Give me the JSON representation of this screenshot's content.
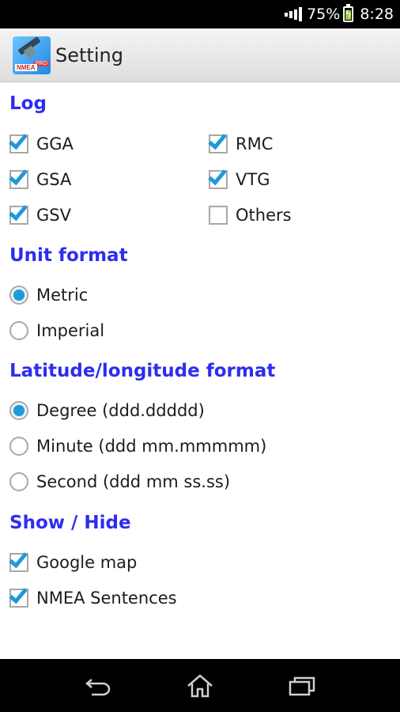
{
  "status_bar": {
    "battery_percent": "75%",
    "time": "8:28"
  },
  "action_bar": {
    "app_icon_text": "NMEA",
    "app_icon_badge": "PRO",
    "title": "Setting"
  },
  "sections": {
    "log": {
      "title": "Log",
      "items": [
        {
          "label": "GGA",
          "checked": true
        },
        {
          "label": "RMC",
          "checked": true
        },
        {
          "label": "GSA",
          "checked": true
        },
        {
          "label": "VTG",
          "checked": true
        },
        {
          "label": "GSV",
          "checked": true
        },
        {
          "label": "Others",
          "checked": false
        }
      ]
    },
    "unit_format": {
      "title": "Unit format",
      "options": [
        {
          "label": "Metric",
          "selected": true
        },
        {
          "label": "Imperial",
          "selected": false
        }
      ]
    },
    "latlon_format": {
      "title": "Latitude/longitude format",
      "options": [
        {
          "label": "Degree (ddd.ddddd)",
          "selected": true
        },
        {
          "label": "Minute (ddd mm.mmmmm)",
          "selected": false
        },
        {
          "label": "Second (ddd mm ss.ss)",
          "selected": false
        }
      ]
    },
    "show_hide": {
      "title": "Show / Hide",
      "items": [
        {
          "label": "Google map",
          "checked": true
        },
        {
          "label": "NMEA Sentences",
          "checked": true
        }
      ]
    }
  },
  "nav_bar": {
    "icons": [
      "back-icon",
      "home-icon",
      "recents-icon"
    ]
  },
  "colors": {
    "section_title": "#2d2df0",
    "accent": "#1e9ad6"
  }
}
